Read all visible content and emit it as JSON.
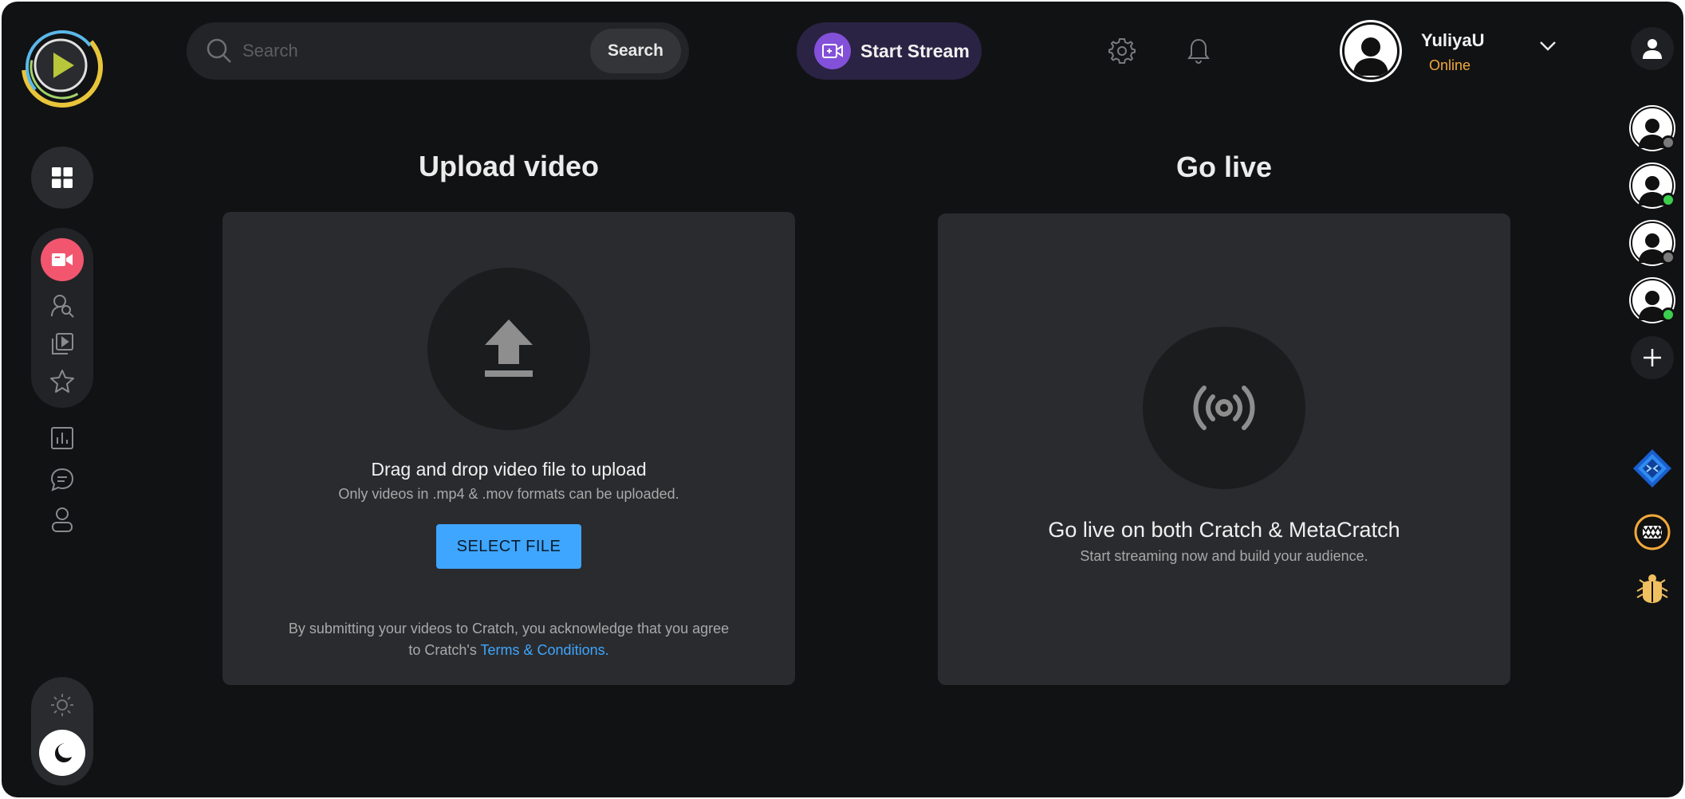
{
  "header": {
    "search_placeholder": "Search",
    "search_button": "Search",
    "start_stream_label": "Start Stream",
    "user": {
      "name": "YuliyaU",
      "status": "Online"
    }
  },
  "upload": {
    "section_title": "Upload video",
    "drag_title": "Drag and drop video file to upload",
    "formats_note": "Only videos in .mp4 & .mov formats can be uploaded.",
    "select_button": "SELECT FILE",
    "terms_line1": "By submitting your videos to Cratch, you acknowledge that you agree",
    "terms_prefix": "to Cratch's ",
    "terms_link": "Terms & Conditions."
  },
  "live": {
    "section_title": "Go live",
    "title": "Go live on both Cratch & MetaCratch",
    "subtitle": "Start streaming now and build your audience."
  },
  "sidebar": {
    "icons": [
      "dashboard-icon",
      "video-camera-icon",
      "user-search-icon",
      "video-library-icon",
      "star-icon",
      "analytics-icon",
      "chat-icon",
      "profile-icon",
      "sun-icon",
      "moon-icon"
    ]
  },
  "friends": [
    {
      "status": "offline",
      "color": "#7a7a7a"
    },
    {
      "status": "online",
      "color": "#3ccf4e"
    },
    {
      "status": "offline",
      "color": "#7a7a7a"
    },
    {
      "status": "online",
      "color": "#3ccf4e"
    }
  ],
  "colors": {
    "background": "#111214",
    "panel": "#2a2b2e",
    "accent_blue": "#3ea6ff",
    "accent_red": "#f2566f",
    "accent_purple": "#8350d9",
    "online_status": "#f2a93b"
  }
}
